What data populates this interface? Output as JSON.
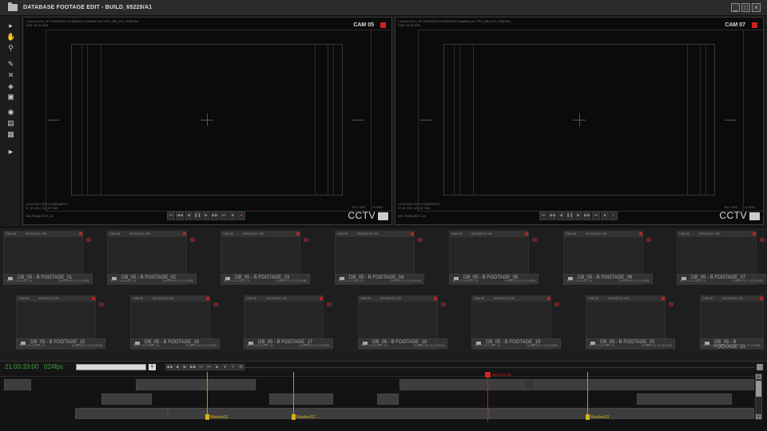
{
  "window": {
    "title": "DATABASE FOOTAGE EDIT - BUILD_65229/A1",
    "minimize": "_",
    "maximize": "□",
    "close": "×"
  },
  "tools": [
    "▸",
    "✋",
    "⚲",
    "✎",
    "✕",
    "◈",
    "▣",
    "◉",
    "▤",
    "▦",
    "►"
  ],
  "monitors": [
    {
      "cam": "CAM 05",
      "meta_top": "| Camera 02/Lic_NF-SHAMS/225.225.86BS6XXX |Satellite Link / RPG_DB6_SSC_4236KMA1",
      "date": "DATE: 09-09-2055",
      "loc1": "LOCATION / GPS COORDINATES:",
      "loc2": "37_45' 00N / 122_00' 00W",
      "loc3": "SAN FRANCISCO, CA",
      "rec_time": "REC TIME",
      "rec_val": "02:09:05",
      "brand": "CCTV"
    },
    {
      "cam": "CAM 07",
      "meta_top": "| Camera 02/Lic_NF-SHAMS/225.225.86BS6XXX |Satellite Link / RPG_DB6_SSC_4236KMA1",
      "date": "DATE: 09-09-2055",
      "loc1": "LOCATION / GPS COORDINATES:",
      "loc2": "37_45' 00N / 122_00' 00W",
      "loc3": "SAN FRANCISCO, CA",
      "rec_time": "REC TIME",
      "rec_val": "02:09:05",
      "brand": "CCTV"
    }
  ],
  "transport": [
    "⏮",
    "◀◀",
    "◀",
    "❚❚",
    "▶",
    "▶▶",
    "⏭",
    "■",
    "●"
  ],
  "bins": [
    {
      "cam": "CAM 05",
      "id": "02/13/04 01 100",
      "name": "DB_05 - B FOOTAGE_01",
      "loc": "SEC LOCATION, CA",
      "dur": "DURATION: 00:23:90/86"
    },
    {
      "cam": "CAM 05",
      "id": "02/13/04 01 100",
      "name": "DB_05 - B FOOTAGE_02",
      "loc": "SEC LOCATION, CA",
      "dur": "DURATION: 00:23:90/86"
    },
    {
      "cam": "CAM 05",
      "id": "02/13/04 01 100",
      "name": "DB_05 - B FOOTAGE_03",
      "loc": "SEC LOCATION, CA",
      "dur": "DURATION: 00:23:90/86"
    },
    {
      "cam": "CAM 05",
      "id": "02/13/04 01 100",
      "name": "DB_05 - B FOOTAGE_04",
      "loc": "SEC LOCATION, CA",
      "dur": "DURATION: 00:23:90/86"
    },
    {
      "cam": "CAM 05",
      "id": "02/13/04 01 100",
      "name": "DB_05 - B FOOTAGE_05",
      "loc": "SEC LOCATION, CA",
      "dur": "DURATION: 00:23:90/86"
    },
    {
      "cam": "CAM 05",
      "id": "02/13/04 01 100",
      "name": "DB_05 - B FOOTAGE_06",
      "loc": "SEC LOCATION, CA",
      "dur": "DURATION: 00:23:90/86"
    },
    {
      "cam": "CAM 05",
      "id": "02/13/04 01 100",
      "name": "DB_05 - B FOOTAGE_07",
      "loc": "SEC LOCATION, CA",
      "dur": "DURATION: 00:23:90/86"
    },
    {
      "cam": "CAM 05",
      "id": "02/13/04 01 100",
      "name": "DB_05 - B FOOTAGE_15",
      "loc": "SEC LOCATION, CA",
      "dur": "DURATION: 00:23:90/86"
    },
    {
      "cam": "CAM 05",
      "id": "02/13/04 01 100",
      "name": "DB_05 - B FOOTAGE_16",
      "loc": "SEC LOCATION, CA",
      "dur": "DURATION: 00:23:90/86"
    },
    {
      "cam": "CAM 05",
      "id": "02/13/04 01 100",
      "name": "DB_05 - B FOOTAGE_17",
      "loc": "SEC LOCATION, CA",
      "dur": "DURATION: 00:23:90/86"
    },
    {
      "cam": "CAM 05",
      "id": "02/13/04 01 100",
      "name": "DB_05 - B FOOTAGE_18",
      "loc": "SEC LOCATION, CA",
      "dur": "DURATION: 00:23:90/86"
    },
    {
      "cam": "CAM 05",
      "id": "02/13/04 01 100",
      "name": "DB_05 - B FOOTAGE_19",
      "loc": "SEC LOCATION, CA",
      "dur": "DURATION: 00:23:90/86"
    },
    {
      "cam": "CAM 05",
      "id": "02/13/04 01 100",
      "name": "DB_05 - B FOOTAGE_20",
      "loc": "SEC LOCATION, CA",
      "dur": "DURATION: 00:23:90/86"
    },
    {
      "cam": "CAM 05",
      "id": "02/13/04 01 100",
      "name": "DB_05 - B FOOTAGE_21",
      "loc": "SEC LOCATION, CA",
      "dur": "DURATION: 00:23:90/86"
    }
  ],
  "timeline": {
    "timecode": "21:00:33:00",
    "fps": "024fps",
    "search_value": "",
    "search_icon": "search-icon",
    "controls": [
      "◀◀",
      "◀",
      "▶",
      "▶▶",
      "⏭",
      "⏮",
      "■",
      "●",
      "✕",
      "⊞"
    ],
    "playhead_label": "00:00:00:00",
    "markers": [
      "Marker01",
      "Marker02",
      "Marker03"
    ]
  }
}
